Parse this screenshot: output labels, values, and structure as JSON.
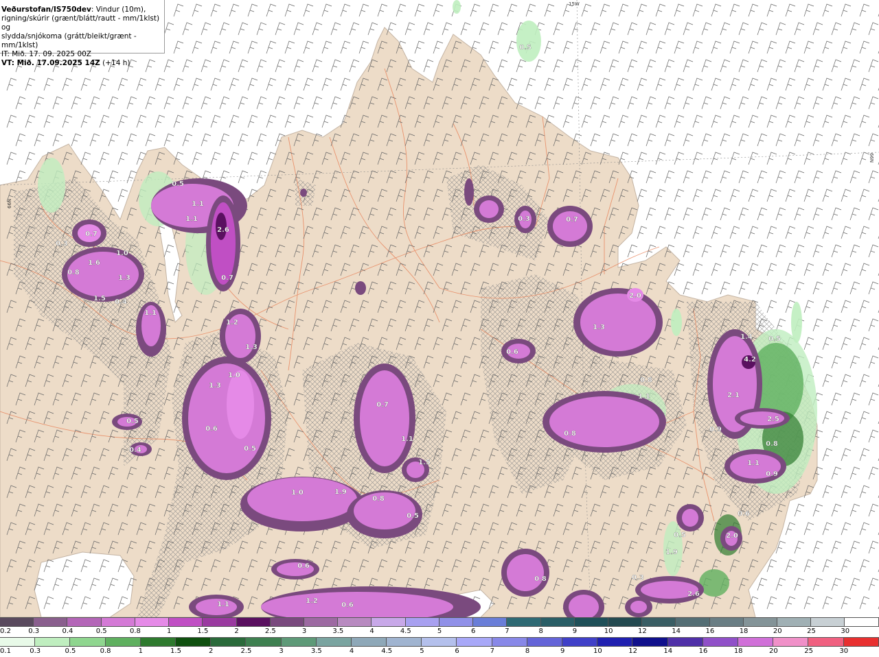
{
  "info": {
    "model": "Veðurstofan/IS750dev",
    "desc_line1": ": Vindur (10m),",
    "desc_line2": "rigning/skúrir (grænt/blátt/rautt - mm/1klst) og",
    "desc_line3": "slydda/snjókoma (grátt/bleikt/grænt - mm/1klst)",
    "it": "IT: Mið. 17. 09. 2025 00Z",
    "vt_label": "VT: Mið. 17.09.2025 14Z",
    "vt_offset": " (+14 h)"
  },
  "map_labels": {
    "lon_top": "15W",
    "lat_left": "66N",
    "lat_right": "66N"
  },
  "colors": {
    "land": "#eddcc8",
    "sea": "#ffffff",
    "roads": "#e8865e",
    "wind_barbs": "#666666",
    "hatch": "#8a8a8a"
  },
  "precip_values": [
    {
      "text": "0.5"
    },
    {
      "text": "0.7"
    },
    {
      "text": "0.3"
    },
    {
      "text": "1.6"
    },
    {
      "text": "1.0"
    },
    {
      "text": "0.8"
    },
    {
      "text": "1.3"
    },
    {
      "text": "1.5"
    },
    {
      "text": "0.4"
    },
    {
      "text": "1.1"
    },
    {
      "text": "0.5"
    },
    {
      "text": "1.1"
    },
    {
      "text": "1.1"
    },
    {
      "text": "2.6"
    },
    {
      "text": "0.7"
    },
    {
      "text": "1.2"
    },
    {
      "text": "1.3"
    },
    {
      "text": "1.3"
    },
    {
      "text": "1.0"
    },
    {
      "text": "0.6"
    },
    {
      "text": "0.5"
    },
    {
      "text": "0.5"
    },
    {
      "text": "0.4"
    },
    {
      "text": "0.6"
    },
    {
      "text": "0.7"
    },
    {
      "text": "1.1"
    },
    {
      "text": "1.5"
    },
    {
      "text": "0.3"
    },
    {
      "text": "0.7"
    },
    {
      "text": "0.6"
    },
    {
      "text": "2.0"
    },
    {
      "text": "1.3"
    },
    {
      "text": "1.1"
    },
    {
      "text": "0.8"
    },
    {
      "text": "0.8"
    },
    {
      "text": "1.0"
    },
    {
      "text": "1.9"
    },
    {
      "text": "0.8"
    },
    {
      "text": "0.5"
    },
    {
      "text": "0.6"
    },
    {
      "text": "1.2"
    },
    {
      "text": "1.1"
    },
    {
      "text": "0.8"
    },
    {
      "text": "1.4"
    },
    {
      "text": "4.2"
    },
    {
      "text": "2.1"
    },
    {
      "text": "0.9"
    },
    {
      "text": "2.5"
    },
    {
      "text": "1.1"
    },
    {
      "text": "0.9"
    },
    {
      "text": "2.0"
    },
    {
      "text": "0.6"
    },
    {
      "text": "0.5"
    },
    {
      "text": "2.6"
    },
    {
      "text": "0.3"
    },
    {
      "text": "1.9"
    },
    {
      "text": "0.8"
    },
    {
      "text": "0.5"
    }
  ],
  "legend_top": {
    "labels": [
      "0.2",
      "0.3",
      "0.4",
      "0.5",
      "0.8",
      "1",
      "1.5",
      "2",
      "2.5",
      "3",
      "3.5",
      "4",
      "4.5",
      "5",
      "6",
      "7",
      "8",
      "9",
      "10",
      "12",
      "14",
      "16",
      "18",
      "20",
      "25",
      "30"
    ],
    "colors": [
      "#5a4a5e",
      "#8a5f8e",
      "#b466b8",
      "#d47ad6",
      "#e58ae7",
      "#c04fc4",
      "#9a3aa0",
      "#5a1060",
      "#7a4a7e",
      "#9d6aa2",
      "#b88ac0",
      "#c8a8e8",
      "#a8a0f0",
      "#9090e8",
      "#6a7ed8",
      "#2e6a74",
      "#2a5e66",
      "#1f5058",
      "#244a50",
      "#3a5e64",
      "#546e74",
      "#6a7e84",
      "#849498",
      "#a0b0b4",
      "#c8d0d4",
      "#ffffff"
    ]
  },
  "legend_bottom": {
    "labels": [
      "0.1",
      "0.3",
      "0.5",
      "0.8",
      "1",
      "1.5",
      "2",
      "2.5",
      "3",
      "3.5",
      "4",
      "4.5",
      "5",
      "6",
      "7",
      "8",
      "9",
      "10",
      "12",
      "14",
      "16",
      "18",
      "20",
      "25",
      "30"
    ],
    "colors": [
      "#e8fae8",
      "#bfeebf",
      "#8fd68f",
      "#5fb05f",
      "#2e7a2e",
      "#0f500f",
      "#2a6a3a",
      "#3e8050",
      "#5e9a78",
      "#7aa4a0",
      "#8ea8b8",
      "#a0b4d0",
      "#b4c0ec",
      "#a8a8f8",
      "#8888e8",
      "#6464d8",
      "#4040c8",
      "#2020b0",
      "#10108c",
      "#5030a8",
      "#9050c8",
      "#d070d8",
      "#f090c8",
      "#f06080",
      "#e83030"
    ]
  }
}
